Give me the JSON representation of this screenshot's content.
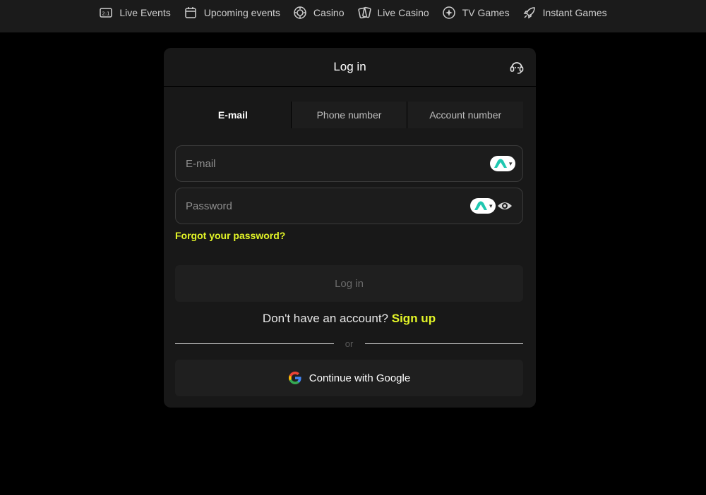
{
  "nav": {
    "items": [
      {
        "label": "Live Events",
        "icon": "scoreboard-icon"
      },
      {
        "label": "Upcoming events",
        "icon": "calendar-icon"
      },
      {
        "label": "Casino",
        "icon": "chip-icon"
      },
      {
        "label": "Live Casino",
        "icon": "cards-icon"
      },
      {
        "label": "TV Games",
        "icon": "sparkle-icon"
      },
      {
        "label": "Instant Games",
        "icon": "rocket-icon"
      }
    ]
  },
  "modal": {
    "title": "Log in",
    "tabs": [
      {
        "label": "E-mail",
        "active": true
      },
      {
        "label": "Phone number",
        "active": false
      },
      {
        "label": "Account number",
        "active": false
      }
    ],
    "email": {
      "placeholder": "E-mail",
      "value": ""
    },
    "password": {
      "placeholder": "Password",
      "value": ""
    },
    "forgot_label": "Forgot your password?",
    "login_label": "Log in",
    "signup_prompt": "Don't have an account?",
    "signup_label": "Sign up",
    "divider_label": "or",
    "google_label": "Continue with Google"
  },
  "colors": {
    "accent": "#e3f527",
    "background": "#000000",
    "panel": "#181818",
    "password_manager": "#1fc7b0"
  }
}
